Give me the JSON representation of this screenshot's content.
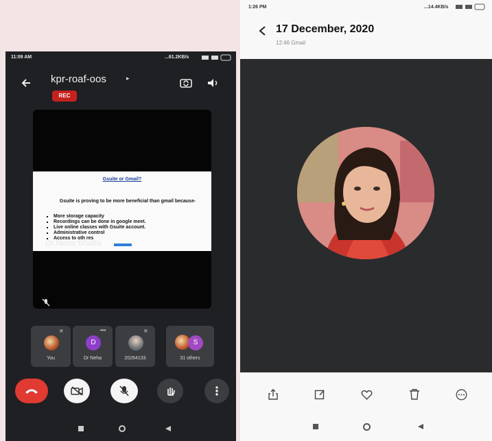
{
  "left_phone": {
    "status": {
      "time": "11:09 AM",
      "right": "...61.2KB/s"
    },
    "meeting_title": "kpr-roaf-oos",
    "rec_badge": "REC",
    "slide": {
      "title": "Gsuite or Gmail?",
      "intro": "Gsuite is proving to be more beneficial than gmail because-",
      "bullets": [
        "More storage capacity",
        "Recordings can be done in google meet.",
        "Live online classes with Gsuite account.",
        "Administrative control",
        "Access to oth                  res"
      ]
    },
    "presenter_name": "Dr.Neha Bhatia",
    "participants": [
      {
        "label": "You"
      },
      {
        "label": "Dr Neha",
        "initial": "D",
        "color": "#8e3fc9"
      },
      {
        "label": "20264133"
      },
      {
        "label": "31 others",
        "initial": "S",
        "color": "#a24ac2"
      }
    ]
  },
  "right_phone": {
    "status": {
      "time": "1:26 PM",
      "right": "...14.4KB/s"
    },
    "date_title": "17 December, 2020",
    "subtitle": "12:46  Gmail"
  },
  "colors": {
    "end_call": "#e03a32",
    "rec": "#c5221f",
    "link": "#1a3d9c"
  }
}
